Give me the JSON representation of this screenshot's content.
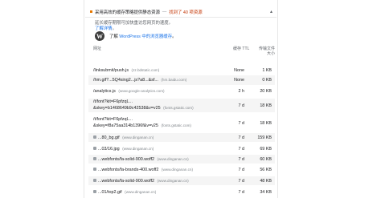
{
  "audit": {
    "title": "采用高效的缓存策略提供静态资源",
    "separator": "—",
    "display_value": "找到了 40 项资源",
    "desc_line1": "延长缓存期限可加快重访您网页的速度。",
    "learn_more": "了解详情",
    "desc_end": "。",
    "wp_prefix": "了解",
    "wp_link": "WordPress 中的浏览器缓存",
    "wp_suffix": "。"
  },
  "table": {
    "headers": {
      "url": "网址",
      "ttl": "缓存 TTL",
      "size_l1": "传输文件",
      "size_l2": "大小"
    },
    "rows": [
      {
        "url": "/linksubmit/push.js",
        "host": "(zz.bdstatic.com)",
        "ttl": "None",
        "size": "1 KB"
      },
      {
        "url": "/hm.gif?...5Q4sing2...js?a8...&sf...",
        "host": "(hm.baidu.com)",
        "ttl": "None",
        "size": "0 KB"
      },
      {
        "url": "/analytics.js",
        "host": "(www.google-analytics.com)",
        "ttl": "2 h",
        "size": "20 KB"
      },
      {
        "url": "/t/font?kit=F6pfzqL...",
        "url2": "&skey=b1468649b9c42538&v=v25",
        "host": "(fonts.gstatic.com)",
        "ttl": "7 d",
        "size": "18 KB"
      },
      {
        "url": "/t/font?kit=F6pfzqL...",
        "url2": "&skey=f8a75aa314b1396f&v=v25",
        "host": "(fonts.gstatic.com)",
        "ttl": "7 d",
        "size": "18 KB"
      },
      {
        "url": "...80_bg.gif",
        "host": "(www.dinganan.cn)",
        "ttl": "7 d",
        "size": "159 KB"
      },
      {
        "url": "...03/16.jpg",
        "host": "(www.dinganan.cn)",
        "ttl": "7 d",
        "size": "69 KB"
      },
      {
        "url": "...webfonts/fa-solid-900.woff2",
        "host": "(www.dinganan.cn)",
        "ttl": "7 d",
        "size": "60 KB"
      },
      {
        "url": "...webfonts/fa-brands-400.woff2",
        "host": "(www.dinganan.cn)",
        "ttl": "7 d",
        "size": "56 KB"
      },
      {
        "url": "...webfonts/fa-solid-900.woff2",
        "host": "(www.dinganan.cn)",
        "ttl": "7 d",
        "size": "48 KB"
      },
      {
        "url": "...01/top2.gif",
        "host": "(www.dinganan.cn)",
        "ttl": "7 d",
        "size": "34 KB"
      }
    ]
  },
  "colors": {
    "warn": "#e67700",
    "link": "#1a73e8",
    "display": "#c33300"
  },
  "icons": {
    "warning": "warning-square-icon",
    "expand": "chevron-up-icon",
    "wordpress": "wordpress-logo"
  }
}
